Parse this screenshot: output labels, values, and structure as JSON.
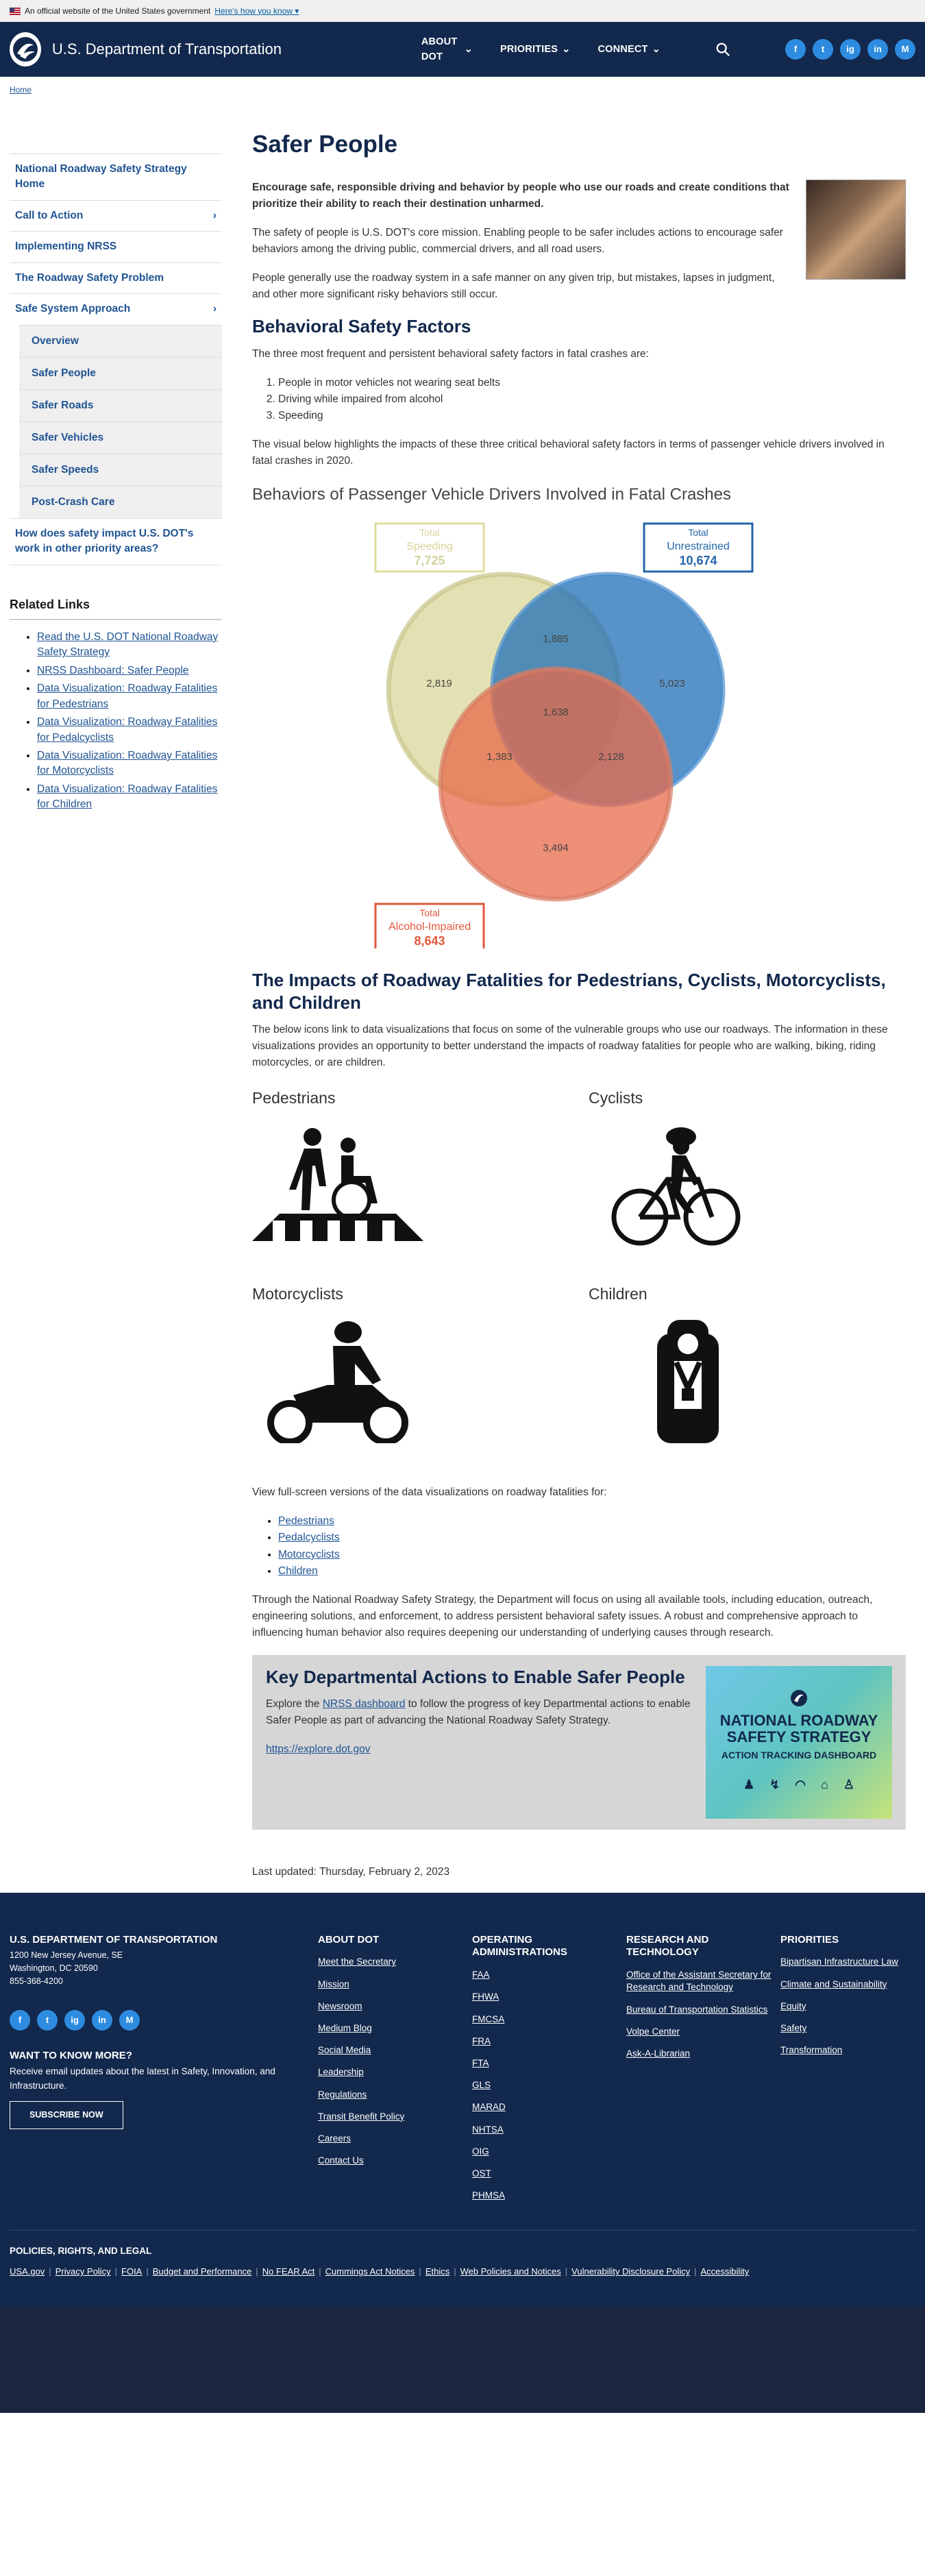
{
  "banner": {
    "text": "An official website of the United States government",
    "link": "Here's how you know"
  },
  "header": {
    "title": "U.S. Department of Transportation",
    "nav": [
      "ABOUT DOT",
      "PRIORITIES",
      "CONNECT"
    ],
    "social": [
      "f",
      "t",
      "ig",
      "in",
      "M"
    ]
  },
  "breadcrumb": "Home",
  "sidebar": {
    "items": [
      {
        "label": "National Roadway Safety Strategy Home"
      },
      {
        "label": "Call to Action"
      },
      {
        "label": "Implementing NRSS"
      },
      {
        "label": "The Roadway Safety Problem"
      },
      {
        "label": "Safe System Approach"
      }
    ],
    "subitems": [
      "Overview",
      "Safer People",
      "Safer Roads",
      "Safer Vehicles",
      "Safer Speeds",
      "Post-Crash Care"
    ],
    "last": "How does safety impact U.S. DOT's work in other priority areas?",
    "related_title": "Related Links",
    "related": [
      "Read the U.S. DOT National Roadway Safety Strategy",
      "NRSS Dashboard: Safer People",
      "Data Visualization: Roadway Fatalities for Pedestrians",
      "Data Visualization: Roadway Fatalities for Pedalcyclists",
      "Data Visualization: Roadway Fatalities for Motorcyclists",
      "Data Visualization: Roadway Fatalities for Children"
    ]
  },
  "main": {
    "title": "Safer People",
    "lead": "Encourage safe, responsible driving and behavior by people who use our roads and create conditions that prioritize their ability to reach their destination unharmed.",
    "p1": "The safety of people is U.S. DOT's core mission. Enabling people to be safer includes actions to encourage safer behaviors among the driving public, commercial drivers, and all road users.",
    "p2": "People generally use the roadway system in a safe manner on any given trip, but mistakes, lapses in judgment, and other more significant risky behaviors still occur.",
    "h_behavioral": "Behavioral Safety Factors",
    "p3": "The three most frequent and persistent behavioral safety factors in fatal crashes are:",
    "factors": [
      "People in motor vehicles not wearing seat belts",
      "Driving while impaired from alcohol",
      "Speeding"
    ],
    "p4": "The visual below highlights the impacts of these three critical behavioral safety factors in terms of passenger vehicle drivers involved in fatal crashes in 2020.",
    "h_impacts": "The Impacts of Roadway Fatalities for Pedestrians, Cyclists, Motorcyclists, and Children",
    "p5": "The below icons link to data visualizations that focus on some of the vulnerable groups who use our roadways. The information in these visualizations provides an opportunity to better understand the impacts of roadway fatalities for people who are walking, biking, riding motorcycles, or are children.",
    "cats": [
      "Pedestrians",
      "Cyclists",
      "Motorcyclists",
      "Children"
    ],
    "p6": "View full-screen versions of the data visualizations on roadway fatalities for:",
    "viz_links": [
      "Pedestrians",
      "Pedalcyclists",
      "Motorcyclists",
      "Children"
    ],
    "p7": "Through the National Roadway Safety Strategy, the Department will focus on using all available tools, including education, outreach, engineering solutions, and enforcement, to address persistent behavioral safety issues. A robust and comprehensive approach to influencing human behavior also requires deepening our understanding of underlying causes through research.",
    "action_title": "Key Departmental Actions to Enable Safer People",
    "action_pre": "Explore the ",
    "action_link": "NRSS dashboard",
    "action_post": " to follow the progress of key Departmental actions to enable Safer People as part of advancing the National Roadway Safety Strategy.",
    "action_url": "https://explore.dot.gov",
    "dash_line1": "NATIONAL ROADWAY",
    "dash_line2": "SAFETY STRATEGY",
    "dash_line3": "ACTION TRACKING DASHBOARD",
    "updated": "Last updated: Thursday, February 2, 2023"
  },
  "chart_data": {
    "type": "venn",
    "title": "Behaviors of Passenger Vehicle Drivers Involved in Fatal Crashes",
    "sets": [
      {
        "name": "Speeding",
        "total_label": "Total",
        "total": "7,725",
        "color": "#d9d79a"
      },
      {
        "name": "Unrestrained",
        "total_label": "Total",
        "total": "10,674",
        "color": "#1f6fb5"
      },
      {
        "name": "Alcohol-Impaired",
        "total_label": "Total",
        "total": "8,643",
        "color": "#e86a4a"
      }
    ],
    "regions": {
      "speeding_only": "2,819",
      "unrestrained_only": "5,023",
      "alcohol_only": "3,494",
      "speeding_unrestrained": "1,885",
      "speeding_alcohol": "1,383",
      "unrestrained_alcohol": "2,128",
      "all_three": "1,638"
    }
  },
  "footer": {
    "org": "U.S. DEPARTMENT OF TRANSPORTATION",
    "addr1": "1200 New Jersey Avenue, SE",
    "addr2": "Washington, DC 20590",
    "phone": "855-368-4200",
    "want": "WANT TO KNOW MORE?",
    "want_text": "Receive email updates about the latest in Safety, Innovation, and Infrastructure.",
    "subscribe": "SUBSCRIBE NOW",
    "cols": [
      {
        "head": "ABOUT DOT",
        "links": [
          "Meet the Secretary",
          "Mission",
          "Newsroom",
          "Medium Blog",
          "Social Media",
          "Leadership",
          "Regulations",
          "Transit Benefit Policy",
          "Careers",
          "Contact Us"
        ]
      },
      {
        "head": "OPERATING ADMINISTRATIONS",
        "links": [
          "FAA",
          "FHWA",
          "FMCSA",
          "FRA",
          "FTA",
          "GLS",
          "MARAD",
          "NHTSA",
          "OIG",
          "OST",
          "PHMSA"
        ]
      },
      {
        "head": "RESEARCH AND TECHNOLOGY",
        "links": [
          "Office of the Assistant Secretary for Research and Technology",
          "Bureau of Transportation Statistics",
          "Volpe Center",
          "Ask-A-Librarian"
        ]
      },
      {
        "head": "PRIORITIES",
        "links": [
          "Bipartisan Infrastructure Law",
          "Climate and Sustainability",
          "Equity",
          "Safety",
          "Transformation"
        ]
      }
    ],
    "legal_head": "POLICIES, RIGHTS, AND LEGAL",
    "legal": [
      "USA.gov",
      "Privacy Policy",
      "FOIA",
      "Budget and Performance",
      "No FEAR Act",
      "Cummings Act Notices",
      "Ethics",
      "Web Policies and Notices",
      "Vulnerability Disclosure Policy",
      "Accessibility"
    ]
  }
}
